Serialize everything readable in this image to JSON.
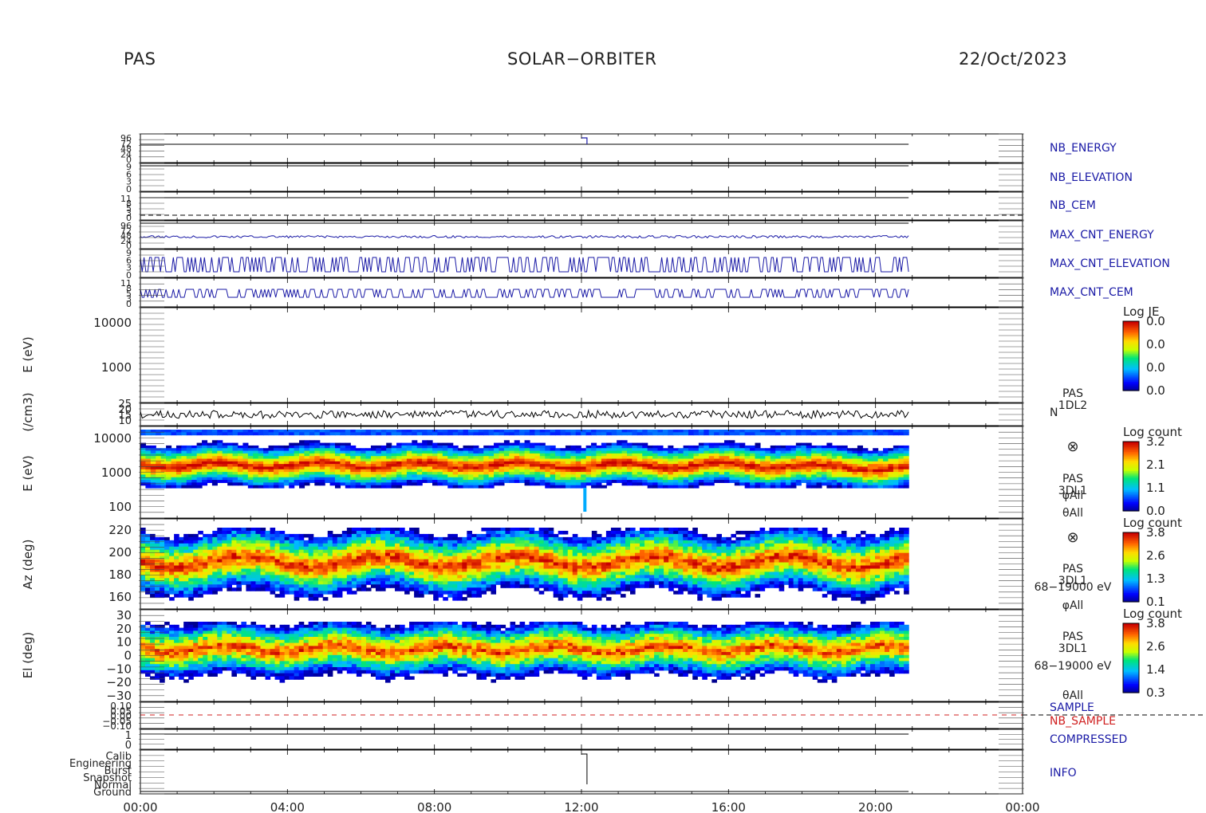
{
  "header": {
    "instrument": "PAS",
    "mission": "SOLAR−ORBITER",
    "date": "22/Oct/2023"
  },
  "colors": {
    "status_blue": "#1a1aa6",
    "nb_sample_red": "#d02020",
    "frame": "#000000"
  },
  "chart_data": {
    "type": "heatmap",
    "time_axis": {
      "start": "00:00",
      "end": "00:00",
      "tick_labels": [
        "00:00",
        "04:00",
        "08:00",
        "12:00",
        "16:00",
        "20:00",
        "00:00"
      ],
      "data_end_hour": 20.9
    },
    "panels": [
      {
        "id": "nb_energy",
        "label": "NB_ENERGY",
        "color": "blue",
        "tick_labels": [
          "96",
          "72",
          "48",
          "24",
          "0"
        ],
        "ylim": [
          0,
          96
        ]
      },
      {
        "id": "nb_elevation",
        "label": "NB_ELEVATION",
        "color": "blue",
        "tick_labels": [
          "9",
          "6",
          "3",
          "0"
        ],
        "ylim": [
          0,
          9
        ]
      },
      {
        "id": "nb_cem",
        "label": "NB_CEM",
        "color": "blue",
        "tick_labels": [
          "11",
          "8",
          "5",
          "3",
          "0"
        ],
        "ylim": [
          0,
          11
        ]
      },
      {
        "id": "max_cnt_energy",
        "label": "MAX_CNT_ENERGY",
        "color": "blue",
        "tick_labels": [
          "96",
          "72",
          "48",
          "24",
          "0"
        ],
        "ylim": [
          0,
          96
        ]
      },
      {
        "id": "max_cnt_elevation",
        "label": "MAX_CNT_ELEVATION",
        "color": "blue",
        "tick_labels": [
          "9",
          "6",
          "3",
          "0"
        ],
        "ylim": [
          0,
          9
        ]
      },
      {
        "id": "max_cnt_cem",
        "label": "MAX_CNT_CEM",
        "color": "blue",
        "tick_labels": [
          "11",
          "8",
          "5",
          "3",
          "0"
        ],
        "ylim": [
          0,
          11
        ]
      },
      {
        "id": "e_1dl2_empty",
        "ylabel": "E (eV)",
        "tick_labels": [
          "10000",
          "1000"
        ],
        "scale": "log",
        "ylim": [
          200,
          20000
        ],
        "colorbar": {
          "title": "Log JE",
          "ticks": [
            "0.0",
            "0.0",
            "0.0",
            "0.0"
          ]
        }
      },
      {
        "id": "density",
        "ylabel": "(/cm3)",
        "series_label": "N",
        "side_label": [
          "PAS",
          "1DL2"
        ],
        "tick_labels": [
          "25",
          "20",
          "15",
          "10"
        ],
        "ylim": [
          8,
          25
        ]
      },
      {
        "id": "e_3dl1",
        "ylabel": "E (eV)",
        "tick_labels": [
          "10000",
          "1000",
          "100"
        ],
        "scale": "log",
        "ylim": [
          50,
          20000
        ],
        "side_label": [
          "PAS",
          "3DL1",
          "φAll",
          "θAll"
        ],
        "symbol": "⊗",
        "colorbar": {
          "title": "Log count",
          "ticks": [
            "3.2",
            "2.1",
            "1.1",
            "0.0"
          ]
        }
      },
      {
        "id": "azimuth",
        "ylabel": "Az (deg)",
        "tick_labels": [
          "220",
          "200",
          "180",
          "160"
        ],
        "ylim": [
          152,
          232
        ],
        "side_label": [
          "PAS",
          "3DL1",
          "68−19000 eV",
          "φAll"
        ],
        "symbol": "⊗",
        "colorbar": {
          "title": "Log count",
          "ticks": [
            "3.8",
            "2.6",
            "1.3",
            "0.1"
          ]
        }
      },
      {
        "id": "elevation",
        "ylabel": "El (deg)",
        "tick_labels": [
          "30",
          "20",
          "10",
          "0",
          "−10",
          "−20",
          "−30"
        ],
        "ylim": [
          -30,
          30
        ],
        "side_label": [
          "PAS",
          "3DL1",
          "68−19000 eV",
          "θAll"
        ],
        "colorbar": {
          "title": "Log count",
          "ticks": [
            "3.8",
            "2.6",
            "1.4",
            "0.3"
          ]
        }
      },
      {
        "id": "sample",
        "label": "SAMPLE",
        "label2": "NB_SAMPLE",
        "tick_labels": [
          "0.10",
          "0.05",
          "0.00",
          "−0.05",
          "−0.10"
        ],
        "ylim": [
          -0.1,
          0.1
        ]
      },
      {
        "id": "compressed",
        "label": "COMPRESSED",
        "tick_labels": [
          "1",
          "0"
        ],
        "ylim": [
          0,
          1
        ]
      },
      {
        "id": "info",
        "label": "INFO",
        "tick_labels": [
          "Calib",
          "Engineering",
          "Burst",
          "Snapshot",
          "Normal",
          "Ground"
        ]
      }
    ]
  }
}
